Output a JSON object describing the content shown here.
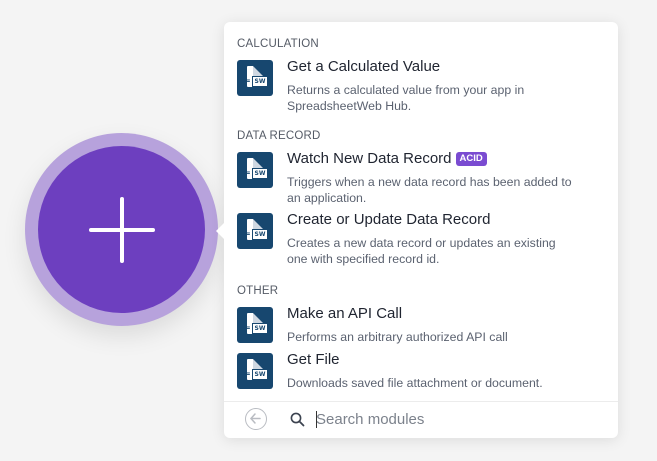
{
  "sections": [
    {
      "title": "CALCULATION",
      "items": [
        {
          "title": "Get a Calculated Value",
          "description": "Returns a calculated value from your app in SpreadsheetWeb Hub.",
          "badge": ""
        }
      ]
    },
    {
      "title": "DATA RECORD",
      "items": [
        {
          "title": "Watch New Data Record",
          "description": "Triggers when a new data record has been added to an application.",
          "badge": "ACID"
        },
        {
          "title": "Create or Update Data Record",
          "description": "Creates a new data record or updates an existing one with specified record id.",
          "badge": ""
        }
      ]
    },
    {
      "title": "OTHER",
      "items": [
        {
          "title": "Make an API Call",
          "description": "Performs an arbitrary authorized API call",
          "badge": ""
        },
        {
          "title": "Get File",
          "description": "Downloads saved file attachment or document.",
          "badge": ""
        }
      ]
    }
  ],
  "icon": {
    "app_icon": "spreadsheetweb-icon",
    "icon_text": "SW",
    "icon_prefix": "="
  },
  "search": {
    "placeholder": "Search modules",
    "value": ""
  },
  "colors": {
    "accent": "#6d3fbf",
    "accent_ring": "#b7a2dc",
    "app_icon_bg": "#17476f",
    "badge_bg": "#7a4bd1"
  }
}
